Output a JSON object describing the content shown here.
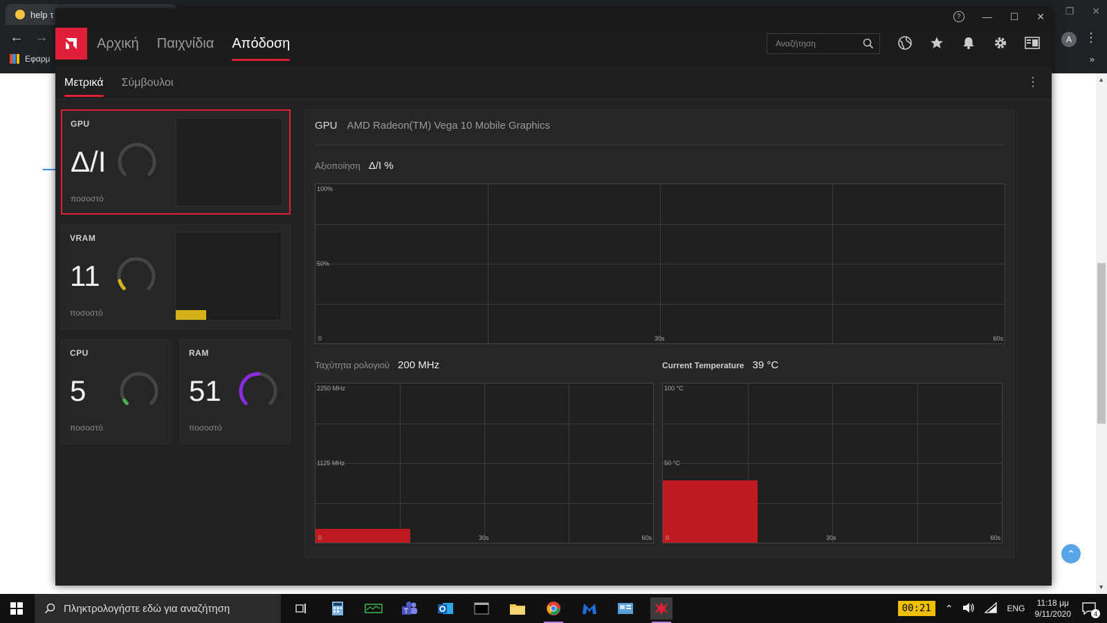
{
  "browser": {
    "tab_title": "help τ",
    "bookmark_label": "Εφαρμ",
    "avatar_letter": "A"
  },
  "header": {
    "nav_tabs": [
      "Αρχική",
      "Παιχνίδια",
      "Απόδοση"
    ],
    "active_tab": "Απόδοση",
    "search_placeholder": "Αναζήτηση",
    "icons": [
      "globe-icon",
      "star-icon",
      "bell-icon",
      "gear-icon",
      "sidebar-icon"
    ]
  },
  "subnav": {
    "tabs": [
      "Μετρικά",
      "Σύμβουλοι"
    ],
    "active_tab": "Μετρικά"
  },
  "cards": {
    "gpu": {
      "label": "GPU",
      "value": "Δ/Ι",
      "unit": "ποσοστό",
      "fraction": 0,
      "color": "#555555"
    },
    "vram": {
      "label": "VRAM",
      "value": "11",
      "unit": "ποσοστό",
      "fraction": 0.11,
      "color": "#d4b21a"
    },
    "cpu": {
      "label": "CPU",
      "value": "5",
      "unit": "ποσοστό",
      "fraction": 0.05,
      "color": "#4caf50"
    },
    "ram": {
      "label": "RAM",
      "value": "51",
      "unit": "ποσοστό",
      "fraction": 0.51,
      "color": "#8a2be2"
    }
  },
  "detail": {
    "device_type": "GPU",
    "device_name": "AMD Radeon(TM) Vega 10 Mobile Graphics",
    "utilization": {
      "label": "Αξιοποίηση",
      "value": "Δ/Ι %"
    },
    "util_chart": {
      "y_top": "100%",
      "y_mid": "50%",
      "x_start": "0",
      "x_mid": "30s",
      "x_end": "60s"
    },
    "clock": {
      "label": "Ταχύτητα ρολογιού",
      "value": "200 MHz"
    },
    "clock_chart": {
      "y_top": "2250 MHz",
      "y_mid": "1125 MHz",
      "x_start": "0",
      "x_mid": "30s",
      "x_end": "60s",
      "fill_fraction_y": 0.089,
      "fill_fraction_x": 0.28
    },
    "temp": {
      "label": "Current Temperature",
      "value": "39 °C"
    },
    "temp_chart": {
      "y_top": "100 °C",
      "y_mid": "50 °C",
      "x_start": "0",
      "x_mid": "30s",
      "x_end": "60s",
      "fill_fraction_y": 0.39,
      "fill_fraction_x": 0.28
    }
  },
  "taskbar": {
    "search_placeholder": "Πληκτρολογήστε εδώ για αναζήτηση",
    "battery_timer": "00:21",
    "language": "ENG",
    "time": "11:18 μμ",
    "date": "9/11/2020",
    "notification_count": "4"
  },
  "colors": {
    "accent": "#e01e37",
    "chart_fill": "#c0191f"
  }
}
